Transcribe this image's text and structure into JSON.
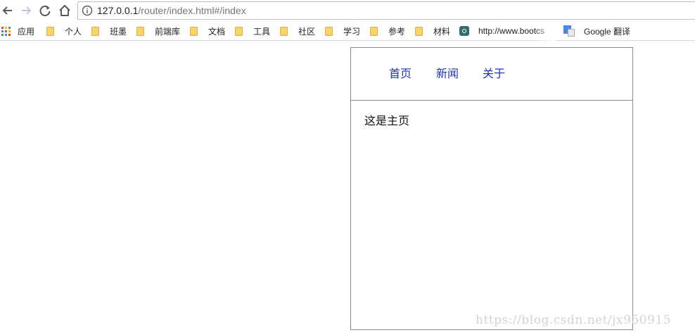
{
  "browser": {
    "url_host": "127.0.0.1",
    "url_path": "/router/index.html#/index"
  },
  "bookmarks": [
    {
      "label": "应用",
      "icon": "apps-grid-icon"
    },
    {
      "label": "个人",
      "icon": "folder-icon"
    },
    {
      "label": "班墨",
      "icon": "folder-icon"
    },
    {
      "label": "前端库",
      "icon": "folder-icon"
    },
    {
      "label": "文档",
      "icon": "folder-icon"
    },
    {
      "label": "工具",
      "icon": "folder-icon"
    },
    {
      "label": "社区",
      "icon": "folder-icon"
    },
    {
      "label": "学习",
      "icon": "folder-icon"
    },
    {
      "label": "参考",
      "icon": "folder-icon"
    },
    {
      "label": "材料",
      "icon": "folder-icon"
    },
    {
      "label": "http://www.bootcs",
      "icon": "bootcss-icon"
    },
    {
      "label": "Google 翻译",
      "icon": "google-translate-icon"
    }
  ],
  "app": {
    "nav": [
      {
        "label": "首页"
      },
      {
        "label": "新闻"
      },
      {
        "label": "关于"
      }
    ],
    "content_text": "这是主页"
  },
  "watermark": "https://blog.csdn.net/jx950915",
  "colors": {
    "link": "#1f35b5",
    "border": "#8a8a8a",
    "folder": "#f6d36b"
  }
}
